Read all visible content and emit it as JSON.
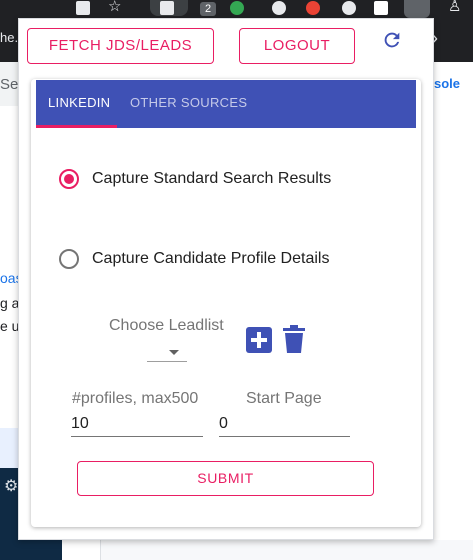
{
  "browser": {
    "tab_text": "he...",
    "address_text": "Sea",
    "extension_badge": "2",
    "console_link": "sole",
    "chevron": "›",
    "left_words": [
      "oas",
      "g ag",
      "e us"
    ]
  },
  "popup": {
    "fetch_button": "FETCH JDS/LEADS",
    "logout_button": "LOGOUT",
    "tabs": [
      {
        "label": "LINKEDIN",
        "active": true
      },
      {
        "label": "OTHER SOURCES",
        "active": false
      }
    ],
    "options": [
      {
        "label": "Capture Standard Search Results",
        "checked": true
      },
      {
        "label": "Capture Candidate Profile Details",
        "checked": false
      }
    ],
    "leadlist": {
      "label": "Choose Leadlist",
      "selected": ""
    },
    "profiles": {
      "label": "#profiles, max500",
      "value": "10"
    },
    "start_page": {
      "label": "Start Page",
      "value": "0"
    },
    "submit": "SUBMIT"
  },
  "colors": {
    "accent": "#e91e63",
    "primary": "#3f51b5"
  },
  "icons": {
    "refresh": "refresh-icon",
    "add": "add-box-icon",
    "delete": "trash-icon",
    "dropdown": "arrow-drop-down-icon"
  }
}
